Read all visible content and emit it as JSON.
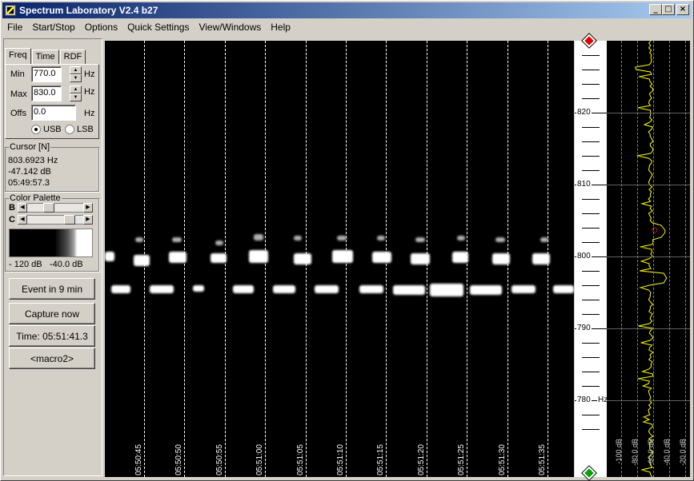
{
  "window": {
    "title": "Spectrum Laboratory V2.4 b27",
    "min_label": "_",
    "max_label": "□",
    "close_label": "×"
  },
  "menu": [
    "File",
    "Start/Stop",
    "Options",
    "Quick Settings",
    "View/Windows",
    "Help"
  ],
  "tabs": [
    "Freq",
    "Time",
    "RDF"
  ],
  "freq": {
    "min_label": "Min",
    "min_value": "770.0",
    "min_unit": "Hz",
    "max_label": "Max",
    "max_value": "830.0",
    "max_unit": "Hz",
    "offs_label": "Offs",
    "offs_value": "0.0",
    "offs_unit": "Hz",
    "usb_label": "USB",
    "lsb_label": "LSB",
    "selected": "USB"
  },
  "cursor": {
    "title": "Cursor [N]",
    "freq": "803.6923 Hz",
    "level": "-47.142 dB",
    "time": "05:49:57.3"
  },
  "palette": {
    "title": "Color Palette",
    "b_label": "B",
    "c_label": "C",
    "b_position": 0.35,
    "c_position": 0.82,
    "min_label": "- 120 dB",
    "max_label": "-40.0 dB"
  },
  "buttons": {
    "event": "Event in 9 min",
    "capture": "Capture now",
    "time": "Time:  05:51:41.3",
    "macro": "<macro2>"
  },
  "time_labels": [
    "05:50:45",
    "05:50:50",
    "05:50:55",
    "05:51:00",
    "05:51:05",
    "05:51:10",
    "05:51:15",
    "05:51:20",
    "05:51:25",
    "05:51:30",
    "05:51:35"
  ],
  "freq_labels": [
    "820",
    "810",
    "800",
    "790",
    "780"
  ],
  "freq_unit": "Hz",
  "db_labels": [
    "-100 dB",
    "-80.0 dB",
    "-60.0 dB",
    "-40.0 dB",
    "-20.0 dB"
  ],
  "colors": {
    "titlebar": "#0a246a",
    "trace": "#ffff00",
    "marker_top": "#e00000",
    "marker_bottom": "#00a000"
  }
}
